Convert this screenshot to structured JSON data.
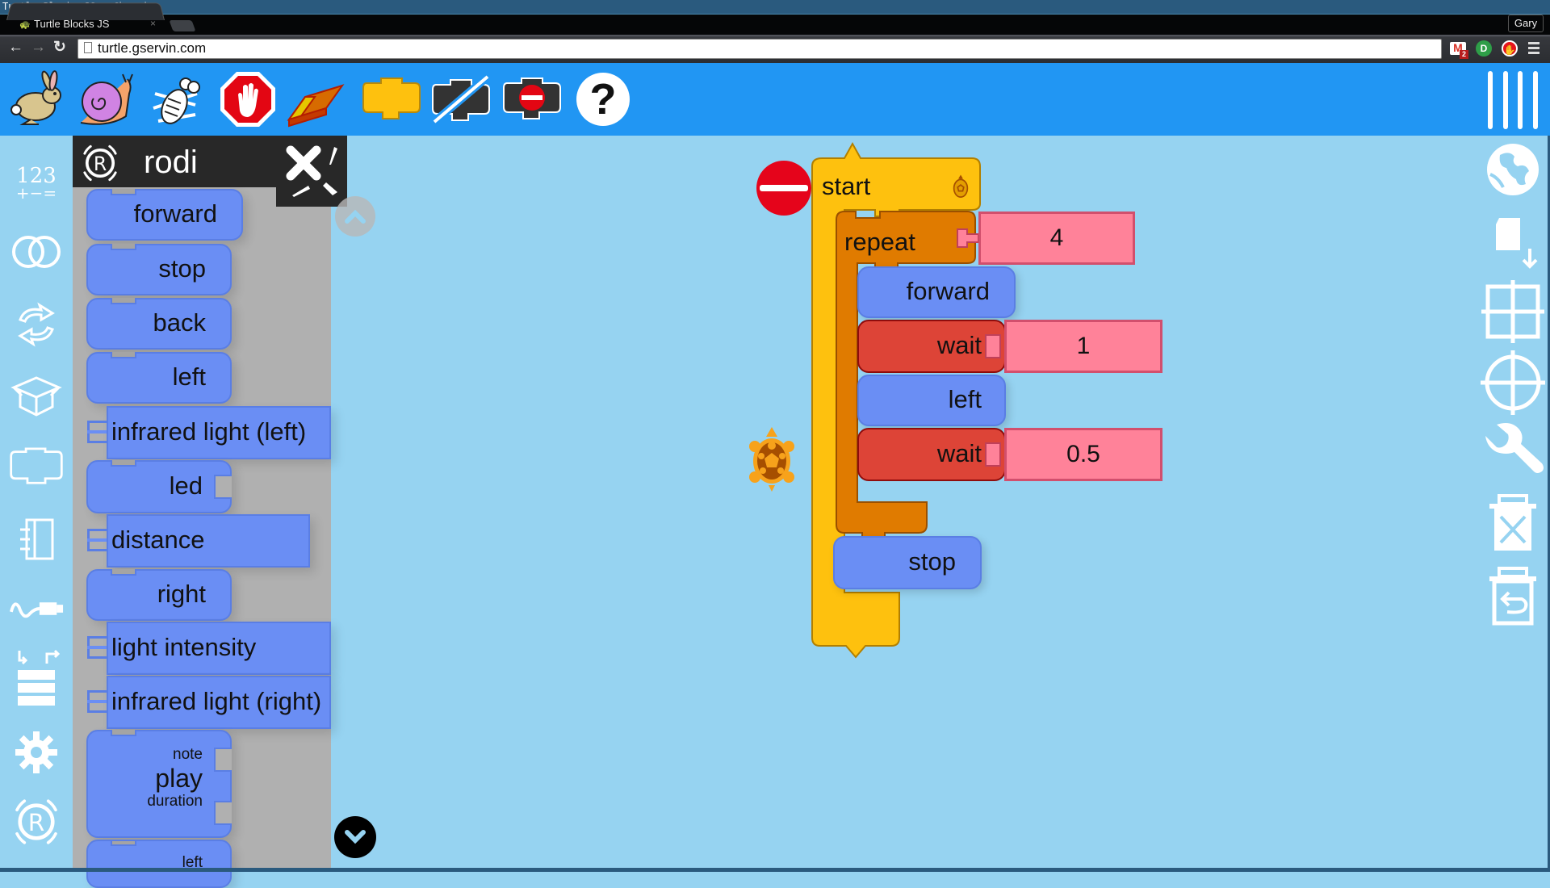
{
  "window": {
    "title": "Turtle Blocks JS - Chromium",
    "user": "Gary"
  },
  "browser": {
    "tab_title": "Turtle Blocks JS",
    "tab_close": "×",
    "url": "turtle.gservin.com",
    "nav": {
      "back": "←",
      "forward": "→",
      "reload": "↻"
    },
    "extensions": [
      {
        "name": "gmail-icon",
        "badge": "2",
        "color": "#d93025"
      },
      {
        "name": "pushbullet-icon",
        "color": "#2e9e48"
      },
      {
        "name": "stop-extension-icon",
        "color": "#e5141b"
      },
      {
        "name": "chrome-menu-icon"
      }
    ]
  },
  "toolbar": {
    "items": [
      {
        "name": "run-fast-button",
        "icon": "rabbit-icon"
      },
      {
        "name": "run-slow-button",
        "icon": "snail-icon"
      },
      {
        "name": "step-button",
        "icon": "bug-icon"
      },
      {
        "name": "stop-button",
        "icon": "stop-hand-icon"
      },
      {
        "name": "clear-button",
        "icon": "eraser-icon"
      },
      {
        "name": "palette-button",
        "icon": "block-icon"
      },
      {
        "name": "hide-blocks-button",
        "icon": "hide-blocks-icon"
      },
      {
        "name": "collapse-blocks-button",
        "icon": "collapse-blocks-icon"
      },
      {
        "name": "help-button",
        "icon": "help-icon",
        "label": "?"
      }
    ],
    "menu_icon": "menu-bars-icon"
  },
  "sidebar": {
    "number_palette": {
      "top": "123",
      "bottom": "+−="
    },
    "items": [
      {
        "name": "sidebar-number",
        "icon": "number-icon"
      },
      {
        "name": "sidebar-boolean",
        "icon": "boolean-icon"
      },
      {
        "name": "sidebar-flow",
        "icon": "flow-icon"
      },
      {
        "name": "sidebar-boxes",
        "icon": "box-icon"
      },
      {
        "name": "sidebar-actions",
        "icon": "action-icon"
      },
      {
        "name": "sidebar-media",
        "icon": "media-icon"
      },
      {
        "name": "sidebar-sensors",
        "icon": "sensors-icon"
      },
      {
        "name": "sidebar-heap",
        "icon": "heap-icon"
      },
      {
        "name": "sidebar-extras",
        "icon": "extras-icon"
      },
      {
        "name": "sidebar-rodi",
        "icon": "rodi-icon"
      }
    ]
  },
  "palette": {
    "title": "rodi",
    "blocks": [
      {
        "label": "forward",
        "kind": "cmd"
      },
      {
        "label": "stop",
        "kind": "cmd"
      },
      {
        "label": "back",
        "kind": "cmd"
      },
      {
        "label": "left",
        "kind": "cmd"
      },
      {
        "label": "infrared light (left)",
        "kind": "arg"
      },
      {
        "label": "led",
        "kind": "cmd-arg"
      },
      {
        "label": "distance",
        "kind": "arg"
      },
      {
        "label": "right",
        "kind": "cmd"
      },
      {
        "label": "light intensity",
        "kind": "arg"
      },
      {
        "label": "infrared light (right)",
        "kind": "arg"
      },
      {
        "label": "play",
        "kind": "cmd-2arg",
        "arg1": "note",
        "arg2": "duration"
      },
      {
        "label": "left",
        "kind": "cmd-arg-partial"
      }
    ]
  },
  "program": {
    "start": {
      "label": "start"
    },
    "repeat": {
      "label": "repeat",
      "count": "4"
    },
    "body": [
      {
        "label": "forward"
      },
      {
        "label": "wait",
        "value": "1"
      },
      {
        "label": "left"
      },
      {
        "label": "wait",
        "value": "0.5"
      }
    ],
    "after": {
      "label": "stop"
    }
  },
  "right_bar": {
    "items": [
      {
        "name": "planet-button",
        "icon": "globe-icon"
      },
      {
        "name": "save-button",
        "icon": "save-icon"
      },
      {
        "name": "grid-button",
        "icon": "grid-icon"
      },
      {
        "name": "polar-button",
        "icon": "crosshair-icon"
      },
      {
        "name": "settings-button",
        "icon": "wrench-icon"
      },
      {
        "name": "delete-button",
        "icon": "trash-icon"
      },
      {
        "name": "restore-button",
        "icon": "restore-trash-icon"
      }
    ]
  },
  "colors": {
    "toolbar": "#2196f3",
    "canvas": "#96d3f1",
    "palette_bg": "#b0b0b0",
    "rodi_block": "#6a8ef4",
    "start_block": "#fec10e",
    "repeat_block": "#e07b00",
    "wait_block": "#dd4437",
    "number_block": "#ff8299"
  }
}
